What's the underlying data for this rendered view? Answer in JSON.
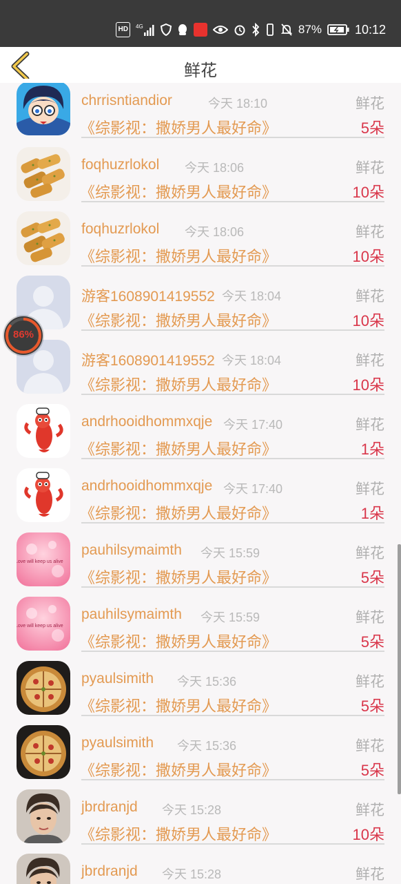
{
  "status_bar": {
    "network": "HD",
    "signal": "4G",
    "battery_percent": "87%",
    "time": "10:12",
    "icons": [
      "hd-icon",
      "signal-4g-icon",
      "shield-icon",
      "qq-icon",
      "app-badge-icon",
      "eye-icon",
      "alarm-icon",
      "bluetooth-icon",
      "vibrate-icon",
      "mute-icon",
      "battery-icon"
    ]
  },
  "header": {
    "title": "鲜花",
    "back_icon": "chevron-left-icon",
    "accent_color": "#f2c94c"
  },
  "float_badge": {
    "label": "86%",
    "progress": 0.86
  },
  "rows": [
    {
      "name": "chrrisntiandior",
      "time": "今天 18:10",
      "type": "鲜花",
      "work": "《综影视：撒娇男人最好命》",
      "qty": "5朵",
      "avatar": "anime-boy"
    },
    {
      "name": "foqhuzrlokol",
      "time": "今天 18:06",
      "type": "鲜花",
      "work": "《综影视：撒娇男人最好命》",
      "qty": "10朵",
      "avatar": "food"
    },
    {
      "name": "foqhuzrlokol",
      "time": "今天 18:06",
      "type": "鲜花",
      "work": "《综影视：撒娇男人最好命》",
      "qty": "10朵",
      "avatar": "food"
    },
    {
      "name": "游客1608901419552",
      "time": "今天 18:04",
      "type": "鲜花",
      "work": "《综影视：撒娇男人最好命》",
      "qty": "10朵",
      "avatar": "default"
    },
    {
      "name": "游客1608901419552",
      "time": "今天 18:04",
      "type": "鲜花",
      "work": "《综影视：撒娇男人最好命》",
      "qty": "10朵",
      "avatar": "default"
    },
    {
      "name": "andrhooidhommxqje",
      "time": "今天 17:40",
      "type": "鲜花",
      "work": "《综影视：撒娇男人最好命》",
      "qty": "1朵",
      "avatar": "crayfish"
    },
    {
      "name": "andrhooidhommxqje",
      "time": "今天 17:40",
      "type": "鲜花",
      "work": "《综影视：撒娇男人最好命》",
      "qty": "1朵",
      "avatar": "crayfish"
    },
    {
      "name": "pauhilsymaimth",
      "time": "今天 15:59",
      "type": "鲜花",
      "work": "《综影视：撒娇男人最好命》",
      "qty": "5朵",
      "avatar": "pink"
    },
    {
      "name": "pauhilsymaimth",
      "time": "今天 15:59",
      "type": "鲜花",
      "work": "《综影视：撒娇男人最好命》",
      "qty": "5朵",
      "avatar": "pink"
    },
    {
      "name": "pyaulsimith",
      "time": "今天 15:36",
      "type": "鲜花",
      "work": "《综影视：撒娇男人最好命》",
      "qty": "5朵",
      "avatar": "pizza"
    },
    {
      "name": "pyaulsimith",
      "time": "今天 15:36",
      "type": "鲜花",
      "work": "《综影视：撒娇男人最好命》",
      "qty": "5朵",
      "avatar": "pizza"
    },
    {
      "name": "jbrdranjd",
      "time": "今天 15:28",
      "type": "鲜花",
      "work": "《综影视：撒娇男人最好命》",
      "qty": "10朵",
      "avatar": "person"
    },
    {
      "name": "jbrdranjd",
      "time": "今天 15:28",
      "type": "鲜花",
      "work": "",
      "qty": "",
      "avatar": "person"
    }
  ],
  "avatar_texts": {
    "pink": "Love will keep us alive"
  }
}
